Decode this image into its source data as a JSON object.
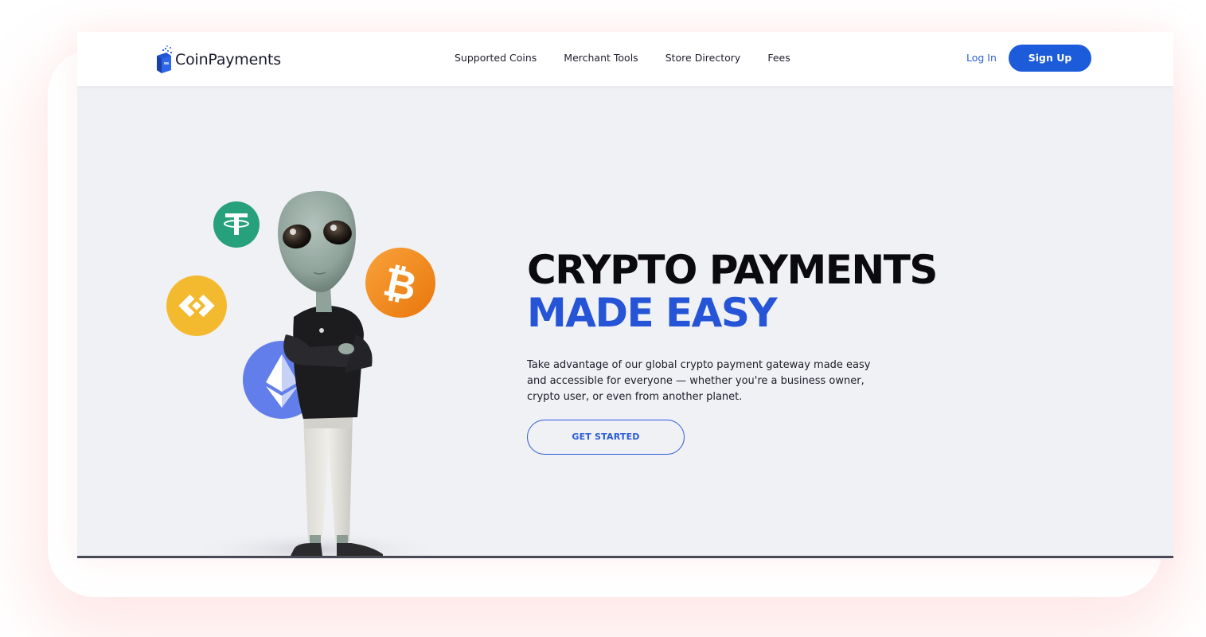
{
  "brand": {
    "name": "CoinPayments"
  },
  "nav": {
    "items": [
      {
        "label": "Supported Coins"
      },
      {
        "label": "Merchant Tools"
      },
      {
        "label": "Store Directory"
      },
      {
        "label": "Fees"
      }
    ],
    "login_label": "Log In",
    "signup_label": "Sign Up"
  },
  "hero": {
    "title_line1": "CRYPTO PAYMENTS",
    "title_line2": "MADE EASY",
    "description": "Take advantage of our global crypto payment gateway made easy and accessible for everyone — whether you're a business owner, crypto user, or even from another planet.",
    "cta_label": "GET STARTED"
  },
  "illustration": {
    "coins": [
      "tether-coin-icon",
      "binance-coin-icon",
      "bitcoin-coin-icon",
      "ethereum-coin-icon"
    ],
    "character": "alien-mascot"
  },
  "colors": {
    "accent": "#2554d6",
    "signup_bg": "#1c5bd9",
    "hero_bg": "#f0f1f5",
    "tether": "#26a17b",
    "binance": "#f3ba2f",
    "bitcoin": "#f7931a",
    "ethereum": "#627eea"
  }
}
